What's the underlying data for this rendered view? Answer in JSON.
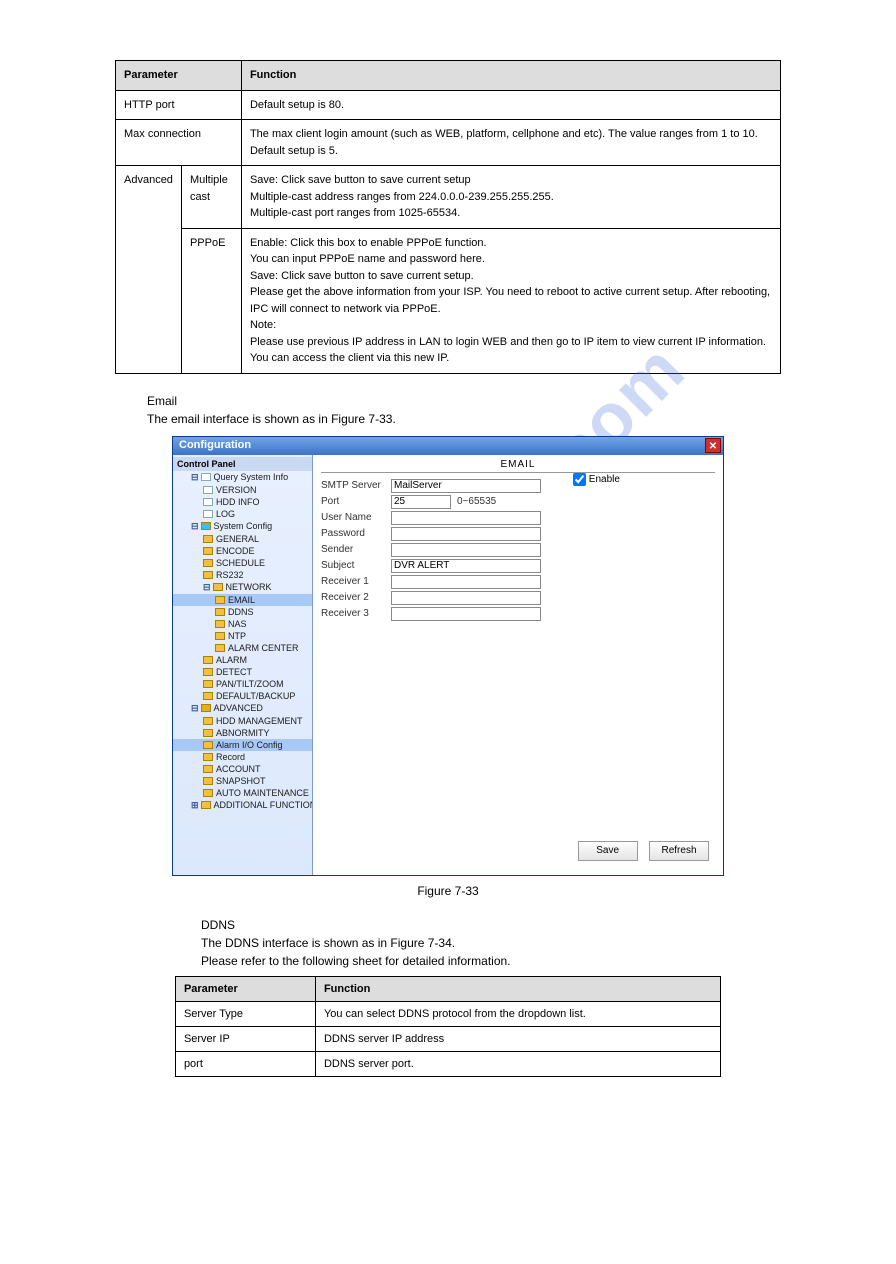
{
  "watermark": "manualshive.com",
  "table1": {
    "head_param": "Parameter",
    "head_func": "Function",
    "rows_simple": [
      {
        "param": "HTTP port",
        "func": "Default setup is 80."
      },
      {
        "param": "Max connection",
        "func": "The max client login amount (such as WEB, platform, cellphone and etc). The value ranges from 1 to 10. Default setup is 5."
      }
    ],
    "adv_label": "Advanced",
    "adv_rows": [
      {
        "sub": "Multiple cast",
        "text": "Save: Click save button to save current setup\nMultiple-cast address ranges from 224.0.0.0-239.255.255.255.\nMultiple-cast port ranges from 1025-65534."
      },
      {
        "sub": "PPPoE",
        "text": "Enable: Click this box to enable PPPoE function.\nYou can input PPPoE name and password here.\nSave: Click save button to save current setup.\nPlease get the above information from your ISP. You need to reboot to active current setup. After rebooting, IPC will connect to network via PPPoE.\nNote:\nPlease use previous IP address in LAN to login WEB and then go to IP item to view current IP information. You can access the client via this new IP."
      }
    ]
  },
  "config": {
    "title": "Configuration",
    "panel_title": "Control Panel",
    "sections": {
      "query": {
        "label": "Query System Info",
        "items": [
          "VERSION",
          "HDD INFO",
          "LOG"
        ]
      },
      "system": {
        "label": "System Config",
        "items": [
          "GENERAL",
          "ENCODE",
          "SCHEDULE",
          "RS232"
        ],
        "network": {
          "label": "NETWORK",
          "sub": [
            "EMAIL",
            "DDNS",
            "NAS",
            "NTP",
            "ALARM CENTER"
          ]
        },
        "tail": [
          "ALARM",
          "DETECT",
          "PAN/TILT/ZOOM",
          "DEFAULT/BACKUP"
        ]
      },
      "advanced": {
        "label": "ADVANCED",
        "items": [
          "HDD MANAGEMENT",
          "ABNORMITY",
          "Alarm I/O Config",
          "Record",
          "ACCOUNT",
          "SNAPSHOT",
          "AUTO MAINTENANCE"
        ]
      },
      "additional": "ADDITIONAL FUNCTION"
    },
    "form": {
      "heading": "EMAIL",
      "smtp_label": "SMTP Server",
      "smtp_val": "MailServer",
      "port_label": "Port",
      "port_val": "25",
      "port_hint": "0~65535",
      "user_label": "User Name",
      "pass_label": "Password",
      "sender_label": "Sender",
      "subject_label": "Subject",
      "subject_val": "DVR ALERT",
      "r1_label": "Receiver 1",
      "r2_label": "Receiver 2",
      "r3_label": "Receiver 3",
      "enable_label": "Enable",
      "save": "Save",
      "refresh": "Refresh"
    }
  },
  "fig_caption": "Figure 7-33",
  "ddns": {
    "heading": "DDNS",
    "intro": "The DDNS interface is shown as in Figure 7-34.\nPlease refer to the following sheet for detailed information.",
    "table": {
      "head_param": "Parameter",
      "head_func": "Function",
      "rows": [
        {
          "param": "Server Type",
          "func": "You can select DDNS protocol from the dropdown list."
        },
        {
          "param": "Server IP",
          "func": "DDNS server IP address"
        },
        {
          "param": "port",
          "func": "DDNS server port."
        }
      ]
    }
  }
}
